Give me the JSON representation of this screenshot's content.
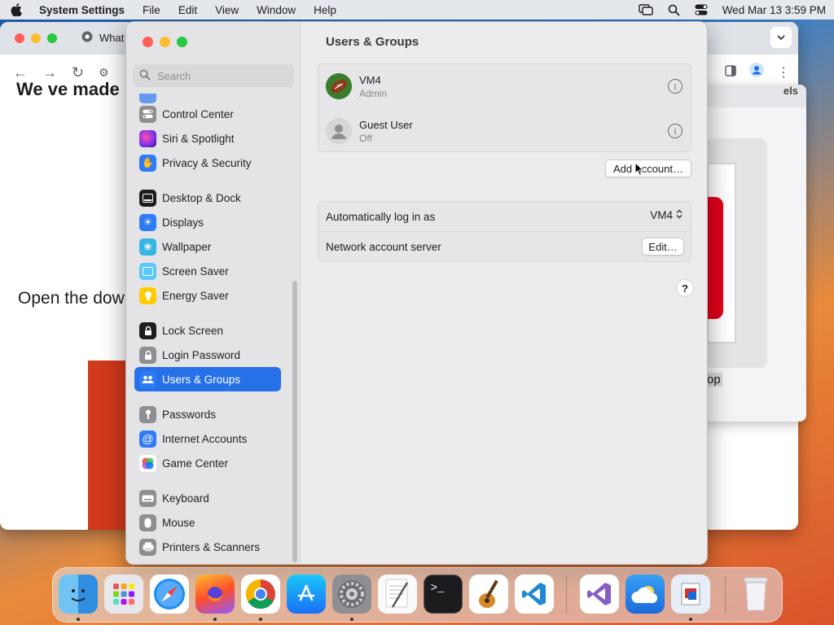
{
  "menubar": {
    "app_name": "System Settings",
    "menus": [
      "File",
      "Edit",
      "View",
      "Window",
      "Help"
    ],
    "clock": "Wed Mar 13  3:59 PM"
  },
  "chrome": {
    "tab_title": "What",
    "page_heading": "We ve made i",
    "open_text": "Open the dow"
  },
  "bgwin": {
    "tab_text": "els",
    "card_text": "op"
  },
  "sidebar": {
    "search_placeholder": "Search",
    "items": [
      {
        "label": "Control Center",
        "icon": "control-center-icon",
        "color": "#8e8e93"
      },
      {
        "label": "Siri & Spotlight",
        "icon": "siri-icon",
        "color": "#b23cd6"
      },
      {
        "label": "Privacy & Security",
        "icon": "hand-icon",
        "color": "#2f7bf5"
      },
      {
        "label": "Desktop & Dock",
        "icon": "dock-icon",
        "color": "#1c1c1e"
      },
      {
        "label": "Displays",
        "icon": "sun-icon",
        "color": "#2f7bf5"
      },
      {
        "label": "Wallpaper",
        "icon": "flower-icon",
        "color": "#33b5e5"
      },
      {
        "label": "Screen Saver",
        "icon": "screen-saver-icon",
        "color": "#5ac8fa"
      },
      {
        "label": "Energy Saver",
        "icon": "bulb-icon",
        "color": "#ffcc00"
      },
      {
        "label": "Lock Screen",
        "icon": "lock-icon",
        "color": "#1c1c1e"
      },
      {
        "label": "Login Password",
        "icon": "lock-icon",
        "color": "#8e8e93"
      },
      {
        "label": "Users & Groups",
        "icon": "users-icon",
        "color": "#2f7bf5"
      },
      {
        "label": "Passwords",
        "icon": "key-icon",
        "color": "#8e8e93"
      },
      {
        "label": "Internet Accounts",
        "icon": "at-icon",
        "color": "#2f7bf5"
      },
      {
        "label": "Game Center",
        "icon": "game-center-icon",
        "color": "#ffffff"
      },
      {
        "label": "Keyboard",
        "icon": "keyboard-icon",
        "color": "#8e8e93"
      },
      {
        "label": "Mouse",
        "icon": "mouse-icon",
        "color": "#8e8e93"
      },
      {
        "label": "Printers & Scanners",
        "icon": "printer-icon",
        "color": "#8e8e93"
      }
    ],
    "selected": "Users & Groups"
  },
  "main": {
    "title": "Users & Groups",
    "users": [
      {
        "name": "VM4",
        "role": "Admin"
      },
      {
        "name": "Guest User",
        "role": "Off"
      }
    ],
    "add_account_label": "Add Account…",
    "options": {
      "auto_login_label": "Automatically log in as",
      "auto_login_value": "VM4",
      "network_server_label": "Network account server",
      "edit_label": "Edit…"
    },
    "help_label": "?"
  },
  "dock": {
    "apps": [
      "Finder",
      "Launchpad",
      "Safari",
      "Firefox",
      "Google Chrome",
      "App Store",
      "System Settings",
      "TextEdit",
      "Terminal",
      "GarageBand",
      "Visual Studio Code",
      "Visual Studio",
      "Cloud",
      "Remote Desktop",
      "Trash"
    ]
  }
}
